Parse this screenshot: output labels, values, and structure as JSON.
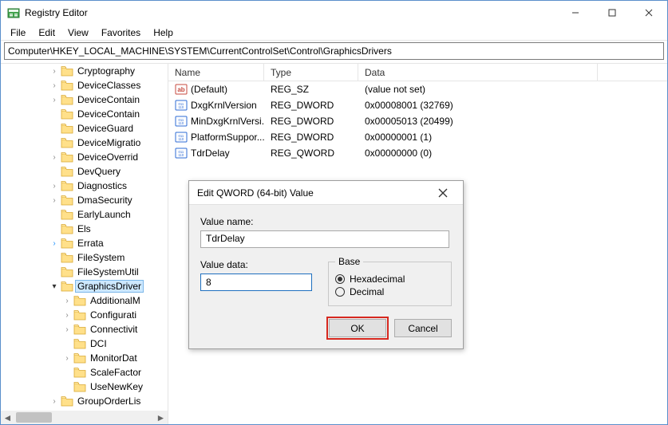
{
  "titlebar": {
    "title": "Registry Editor"
  },
  "menu": {
    "file": "File",
    "edit": "Edit",
    "view": "View",
    "favorites": "Favorites",
    "help": "Help"
  },
  "address": "Computer\\HKEY_LOCAL_MACHINE\\SYSTEM\\CurrentControlSet\\Control\\GraphicsDrivers",
  "tree": {
    "items": [
      {
        "label": "Cryptography",
        "indent": 4,
        "exp": ">"
      },
      {
        "label": "DeviceClasses",
        "indent": 4,
        "exp": ">"
      },
      {
        "label": "DeviceContain",
        "indent": 4,
        "exp": ">"
      },
      {
        "label": "DeviceContain",
        "indent": 4,
        "exp": ""
      },
      {
        "label": "DeviceGuard",
        "indent": 4,
        "exp": ""
      },
      {
        "label": "DeviceMigratio",
        "indent": 4,
        "exp": ""
      },
      {
        "label": "DeviceOverrid",
        "indent": 4,
        "exp": ">"
      },
      {
        "label": "DevQuery",
        "indent": 4,
        "exp": ""
      },
      {
        "label": "Diagnostics",
        "indent": 4,
        "exp": ">"
      },
      {
        "label": "DmaSecurity",
        "indent": 4,
        "exp": ">"
      },
      {
        "label": "EarlyLaunch",
        "indent": 4,
        "exp": ""
      },
      {
        "label": "Els",
        "indent": 4,
        "exp": ""
      },
      {
        "label": "Errata",
        "indent": 4,
        "exp": ">",
        "expClass": "blue"
      },
      {
        "label": "FileSystem",
        "indent": 4,
        "exp": ""
      },
      {
        "label": "FileSystemUtil",
        "indent": 4,
        "exp": ""
      },
      {
        "label": "GraphicsDriver",
        "indent": 4,
        "exp": "v",
        "expClass": "opened",
        "selected": true
      },
      {
        "label": "AdditionalM",
        "indent": 5,
        "exp": ">"
      },
      {
        "label": "Configurati",
        "indent": 5,
        "exp": ">"
      },
      {
        "label": "Connectivit",
        "indent": 5,
        "exp": ">"
      },
      {
        "label": "DCI",
        "indent": 5,
        "exp": ""
      },
      {
        "label": "MonitorDat",
        "indent": 5,
        "exp": ">"
      },
      {
        "label": "ScaleFactor",
        "indent": 5,
        "exp": ""
      },
      {
        "label": "UseNewKey",
        "indent": 5,
        "exp": ""
      },
      {
        "label": "GroupOrderLis",
        "indent": 4,
        "exp": ">"
      }
    ]
  },
  "list": {
    "headers": {
      "name": "Name",
      "type": "Type",
      "data": "Data"
    },
    "rows": [
      {
        "icon": "str",
        "name": "(Default)",
        "type": "REG_SZ",
        "data": "(value not set)"
      },
      {
        "icon": "bin",
        "name": "DxgKrnlVersion",
        "type": "REG_DWORD",
        "data": "0x00008001 (32769)"
      },
      {
        "icon": "bin",
        "name": "MinDxgKrnlVersi...",
        "type": "REG_DWORD",
        "data": "0x00005013 (20499)"
      },
      {
        "icon": "bin",
        "name": "PlatformSuppor...",
        "type": "REG_DWORD",
        "data": "0x00000001 (1)"
      },
      {
        "icon": "bin",
        "name": "TdrDelay",
        "type": "REG_QWORD",
        "data": "0x00000000 (0)"
      }
    ]
  },
  "dialog": {
    "title": "Edit QWORD (64-bit) Value",
    "valueNameLabel": "Value name:",
    "valueName": "TdrDelay",
    "valueDataLabel": "Value data:",
    "valueData": "8",
    "baseLabel": "Base",
    "hex": "Hexadecimal",
    "dec": "Decimal",
    "baseSelected": "hex",
    "ok": "OK",
    "cancel": "Cancel"
  }
}
